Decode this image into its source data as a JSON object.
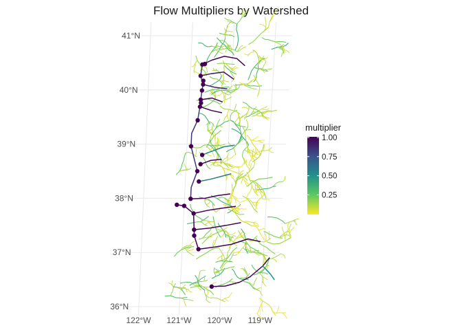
{
  "title": "Flow Multipliers by Watershed",
  "chart_data": {
    "type": "map",
    "xlabel": "",
    "ylabel": "",
    "lat_ticks": [
      {
        "value": 41,
        "label": "41°N"
      },
      {
        "value": 40,
        "label": "40°N"
      },
      {
        "value": 39,
        "label": "39°N"
      },
      {
        "value": 38,
        "label": "38°N"
      },
      {
        "value": 37,
        "label": "37°N"
      },
      {
        "value": 36,
        "label": "36°N"
      }
    ],
    "lon_ticks": [
      {
        "value": -122,
        "label": "122°W"
      },
      {
        "value": -121,
        "label": "121°W"
      },
      {
        "value": -120,
        "label": "120°W"
      },
      {
        "value": -119,
        "label": "119°W"
      }
    ],
    "legend": {
      "title": "multiplier",
      "ticks": [
        {
          "value": 1.0,
          "label": "1.00"
        },
        {
          "value": 0.75,
          "label": "0.75"
        },
        {
          "value": 0.5,
          "label": "0.50"
        },
        {
          "value": 0.25,
          "label": "0.25"
        }
      ],
      "range": [
        0.0,
        1.0
      ],
      "colormap": "viridis"
    },
    "colors": {
      "low": "#fde725",
      "mid": "#21918c",
      "high": "#440154",
      "grid": "#e8e8e8"
    },
    "outlets": [
      {
        "lon": -120.72,
        "lat": 40.47
      },
      {
        "lon": -120.66,
        "lat": 40.48
      },
      {
        "lon": -120.75,
        "lat": 40.26
      },
      {
        "lon": -120.68,
        "lat": 40.17
      },
      {
        "lon": -120.68,
        "lat": 40.1
      },
      {
        "lon": -120.7,
        "lat": 39.99
      },
      {
        "lon": -120.72,
        "lat": 39.82
      },
      {
        "lon": -120.71,
        "lat": 39.76
      },
      {
        "lon": -120.73,
        "lat": 39.69
      },
      {
        "lon": -120.77,
        "lat": 39.44
      },
      {
        "lon": -120.9,
        "lat": 38.96
      },
      {
        "lon": -120.62,
        "lat": 38.8
      },
      {
        "lon": -120.65,
        "lat": 38.63
      },
      {
        "lon": -120.72,
        "lat": 38.5
      },
      {
        "lon": -120.67,
        "lat": 38.31
      },
      {
        "lon": -120.85,
        "lat": 37.99
      },
      {
        "lon": -121.18,
        "lat": 37.88
      },
      {
        "lon": -121.0,
        "lat": 37.86
      },
      {
        "lon": -120.76,
        "lat": 37.72
      },
      {
        "lon": -120.73,
        "lat": 37.42
      },
      {
        "lon": -120.72,
        "lat": 37.31
      },
      {
        "lon": -120.6,
        "lat": 37.06
      },
      {
        "lon": -120.23,
        "lat": 36.37
      }
    ],
    "main_stems": [
      {
        "value": 1.0,
        "points": [
          [
            -120.72,
            40.47
          ],
          [
            -120.5,
            40.55
          ],
          [
            -120.2,
            40.62
          ],
          [
            -119.9,
            40.58
          ],
          [
            -119.7,
            40.45
          ]
        ]
      },
      {
        "value": 0.95,
        "points": [
          [
            -120.75,
            40.26
          ],
          [
            -120.5,
            40.3
          ],
          [
            -120.2,
            40.33
          ],
          [
            -119.95,
            40.2
          ]
        ]
      },
      {
        "value": 0.9,
        "points": [
          [
            -120.68,
            40.1
          ],
          [
            -120.4,
            40.05
          ],
          [
            -120.1,
            40.02
          ]
        ]
      },
      {
        "value": 1.0,
        "points": [
          [
            -120.72,
            39.82
          ],
          [
            -120.45,
            39.85
          ],
          [
            -120.2,
            39.78
          ]
        ]
      },
      {
        "value": 1.0,
        "points": [
          [
            -120.73,
            39.69
          ],
          [
            -120.45,
            39.62
          ],
          [
            -120.2,
            39.58
          ]
        ]
      },
      {
        "value": 0.55,
        "points": [
          [
            -120.62,
            38.8
          ],
          [
            -120.35,
            38.88
          ],
          [
            -120.1,
            38.95
          ],
          [
            -119.85,
            38.98
          ]
        ]
      },
      {
        "value": 1.0,
        "points": [
          [
            -120.65,
            38.63
          ],
          [
            -120.4,
            38.7
          ],
          [
            -120.15,
            38.72
          ]
        ]
      },
      {
        "value": 0.6,
        "points": [
          [
            -120.67,
            38.31
          ],
          [
            -120.4,
            38.35
          ],
          [
            -120.15,
            38.4
          ],
          [
            -119.9,
            38.45
          ]
        ]
      },
      {
        "value": 1.0,
        "points": [
          [
            -120.85,
            37.99
          ],
          [
            -120.5,
            38.0
          ],
          [
            -120.2,
            38.05
          ],
          [
            -119.9,
            38.08
          ]
        ]
      },
      {
        "value": 1.0,
        "points": [
          [
            -120.76,
            37.72
          ],
          [
            -120.4,
            37.78
          ],
          [
            -120.05,
            37.82
          ],
          [
            -119.75,
            37.85
          ]
        ]
      },
      {
        "value": 1.0,
        "points": [
          [
            -120.73,
            37.42
          ],
          [
            -120.35,
            37.45
          ],
          [
            -119.95,
            37.5
          ],
          [
            -119.6,
            37.55
          ]
        ]
      },
      {
        "value": 1.0,
        "points": [
          [
            -120.6,
            37.06
          ],
          [
            -120.2,
            37.1
          ],
          [
            -119.8,
            37.15
          ],
          [
            -119.4,
            37.25
          ],
          [
            -119.1,
            37.2
          ]
        ]
      },
      {
        "value": 1.0,
        "points": [
          [
            -120.23,
            36.37
          ],
          [
            -119.9,
            36.38
          ],
          [
            -119.55,
            36.45
          ],
          [
            -119.3,
            36.55
          ],
          [
            -119.0,
            36.75
          ],
          [
            -118.85,
            36.9
          ]
        ]
      },
      {
        "value": 0.5,
        "points": [
          [
            -119.0,
            36.75
          ],
          [
            -118.8,
            36.6
          ],
          [
            -118.7,
            36.5
          ]
        ]
      },
      {
        "value": 1.0,
        "points": [
          [
            -121.18,
            37.88
          ],
          [
            -121.0,
            37.86
          ],
          [
            -120.76,
            37.72
          ],
          [
            -120.73,
            37.42
          ],
          [
            -120.72,
            37.31
          ],
          [
            -120.6,
            37.06
          ]
        ]
      },
      {
        "value": 0.85,
        "points": [
          [
            -120.77,
            39.44
          ],
          [
            -120.9,
            39.2
          ],
          [
            -120.9,
            38.96
          ],
          [
            -120.8,
            38.7
          ],
          [
            -120.72,
            38.5
          ],
          [
            -120.85,
            38.2
          ],
          [
            -120.85,
            37.99
          ]
        ]
      },
      {
        "value": 0.8,
        "points": [
          [
            -120.72,
            40.47
          ],
          [
            -120.75,
            40.26
          ],
          [
            -120.68,
            40.1
          ],
          [
            -120.7,
            39.99
          ],
          [
            -120.72,
            39.82
          ],
          [
            -120.73,
            39.69
          ],
          [
            -120.77,
            39.44
          ]
        ]
      }
    ]
  }
}
